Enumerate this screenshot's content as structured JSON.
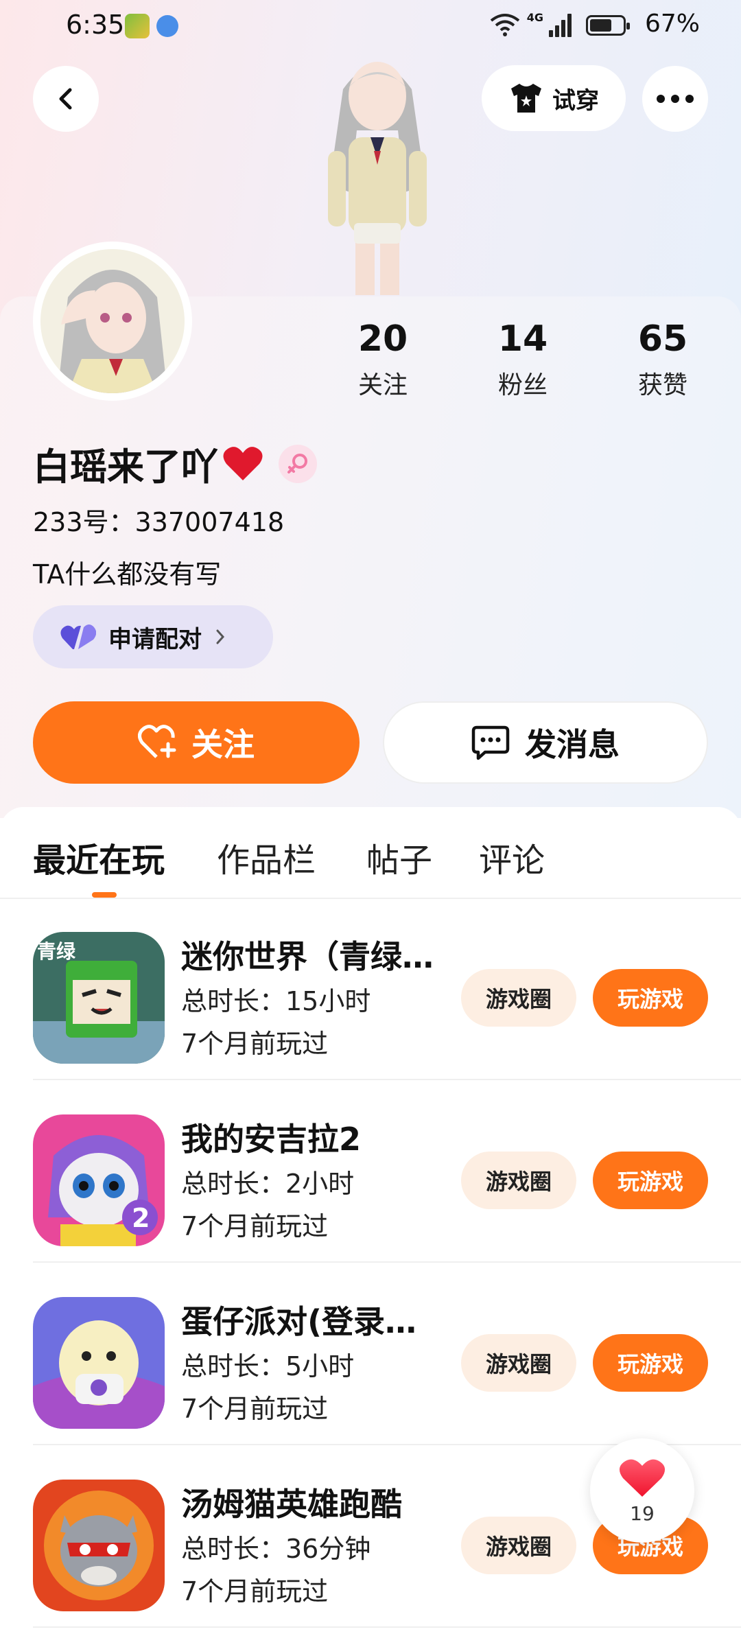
{
  "status_bar": {
    "time": "6:35",
    "network": "4G",
    "battery": "67%",
    "battery_level": 0.67
  },
  "header": {
    "back_icon": "chevron-left-icon",
    "try_on_label": "试穿",
    "more_icon": "more-horizontal-icon"
  },
  "profile": {
    "stats": [
      {
        "value": "20",
        "label": "关注"
      },
      {
        "value": "14",
        "label": "粉丝"
      },
      {
        "value": "65",
        "label": "获赞"
      }
    ],
    "name": "白瑶来了吖",
    "name_emoji": "heart-icon",
    "gender_icon": "female-icon",
    "id_line": "233号：337007418",
    "bio": "TA什么都没有写",
    "pair_label": "申请配对",
    "follow_label": "关注",
    "message_label": "发消息"
  },
  "tabs": [
    {
      "label": "最近在玩",
      "active": true
    },
    {
      "label": "作品栏",
      "active": false
    },
    {
      "label": "帖子",
      "active": false
    },
    {
      "label": "评论",
      "active": false
    }
  ],
  "games": [
    {
      "title": "迷你世界（青绿…",
      "duration": "总时长：15小时",
      "last_played": "7个月前玩过",
      "circle_label": "游戏圈",
      "play_label": "玩游戏",
      "icon_text": "青绿"
    },
    {
      "title": "我的安吉拉2",
      "duration": "总时长：2小时",
      "last_played": "7个月前玩过",
      "circle_label": "游戏圈",
      "play_label": "玩游戏",
      "icon_text": "2"
    },
    {
      "title": "蛋仔派对(登录…",
      "duration": "总时长：5小时",
      "last_played": "7个月前玩过",
      "circle_label": "游戏圈",
      "play_label": "玩游戏",
      "icon_text": ""
    },
    {
      "title": "汤姆猫英雄跑酷",
      "duration": "总时长：36分钟",
      "last_played": "7个月前玩过",
      "circle_label": "游戏圈",
      "play_label": "玩游戏",
      "icon_text": ""
    }
  ],
  "floating_like": {
    "count": "19"
  },
  "colors": {
    "accent": "#ff7418",
    "circle_bg": "#fdeee2",
    "pair_bg": "#e6e3f6"
  }
}
